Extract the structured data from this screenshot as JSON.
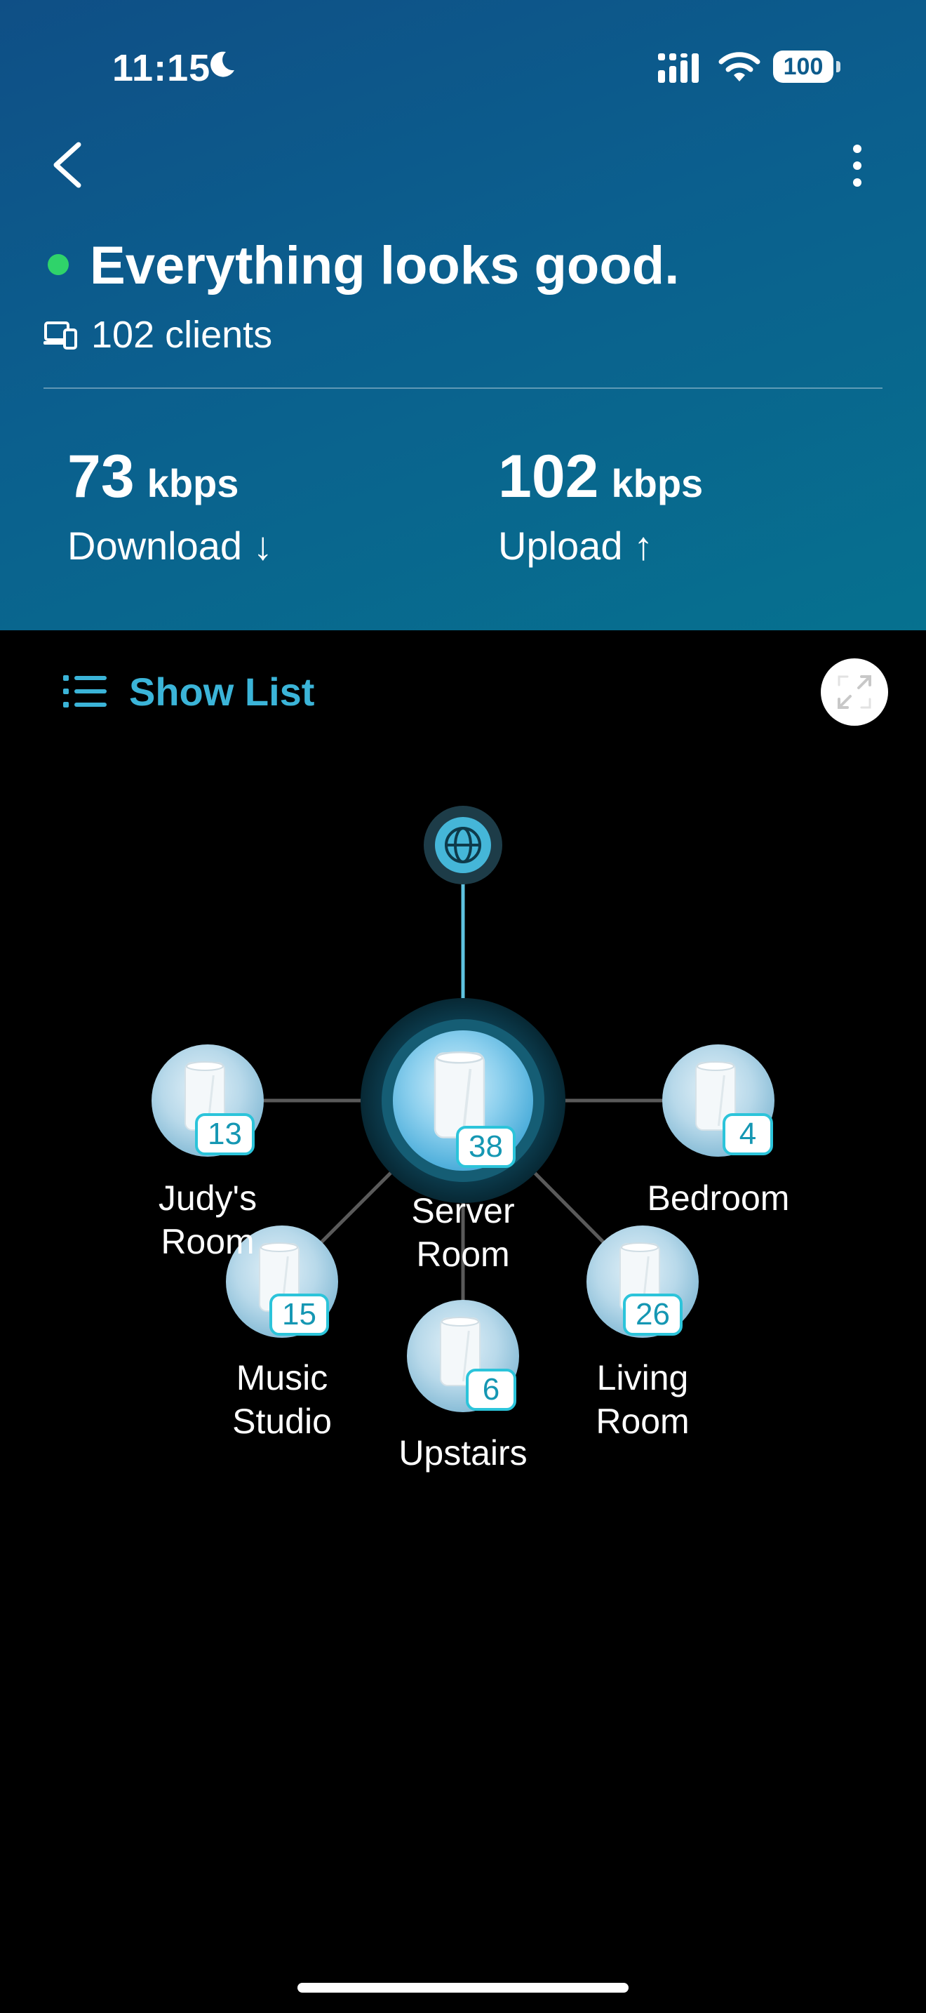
{
  "status_bar": {
    "time": "11:15",
    "battery": "100"
  },
  "header": {
    "headline": "Everything looks good.",
    "clients": "102 clients",
    "download": {
      "value": "73",
      "unit": "kbps",
      "label": "Download ↓"
    },
    "upload": {
      "value": "102",
      "unit": "kbps",
      "label": "Upload ↑"
    },
    "status_color": "#2fd36a"
  },
  "toolbar": {
    "show_list_label": "Show List",
    "accent": "#3bb4d8"
  },
  "nodes": [
    {
      "id": "server-room",
      "label_lines": [
        "Server",
        "Room"
      ],
      "clients": "38",
      "main": true
    },
    {
      "id": "judys-room",
      "label_lines": [
        "Judy's",
        "Room"
      ],
      "clients": "13"
    },
    {
      "id": "bedroom",
      "label_lines": [
        "Bedroom"
      ],
      "clients": "4"
    },
    {
      "id": "music-studio",
      "label_lines": [
        "Music",
        "Studio"
      ],
      "clients": "15"
    },
    {
      "id": "upstairs",
      "label_lines": [
        "Upstairs"
      ],
      "clients": "6"
    },
    {
      "id": "living-room",
      "label_lines": [
        "Living",
        "Room"
      ],
      "clients": "26"
    }
  ]
}
